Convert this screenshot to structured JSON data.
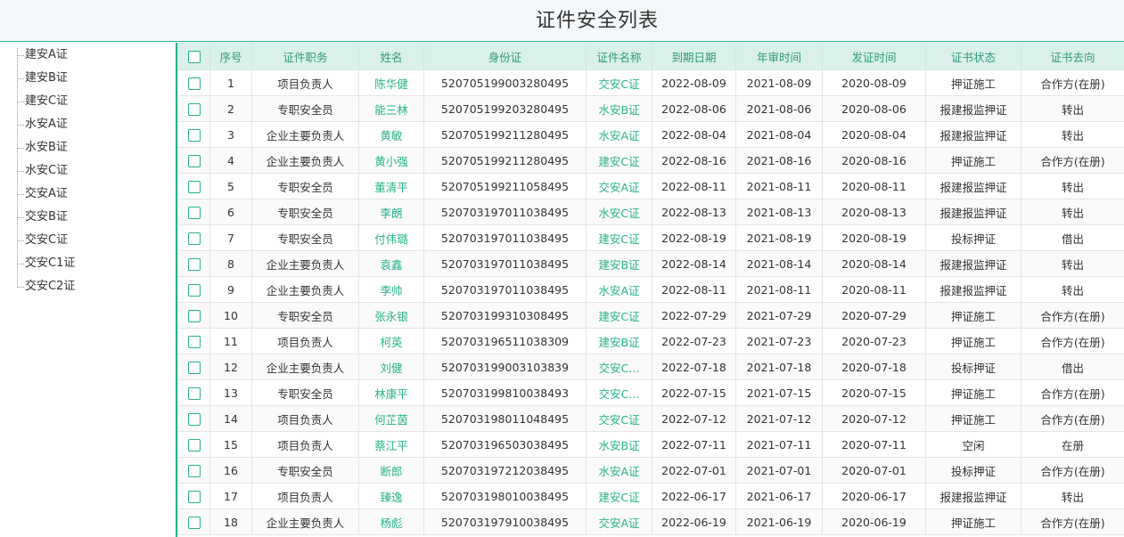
{
  "page": {
    "title": "证件安全列表"
  },
  "tree": {
    "items": [
      {
        "label": "建安A证"
      },
      {
        "label": "建安B证"
      },
      {
        "label": "建安C证"
      },
      {
        "label": "水安A证"
      },
      {
        "label": "水安B证"
      },
      {
        "label": "水安C证"
      },
      {
        "label": "交安A证"
      },
      {
        "label": "交安B证"
      },
      {
        "label": "交安C证"
      },
      {
        "label": "交安C1证"
      },
      {
        "label": "交安C2证"
      }
    ]
  },
  "table": {
    "columns": [
      "序号",
      "证件职务",
      "姓名",
      "身份证",
      "证件名称",
      "到期日期",
      "年审时间",
      "发证时间",
      "证书状态",
      "证书去向"
    ],
    "rows": [
      [
        "1",
        "项目负责人",
        "陈华健",
        "520705199003280495",
        "交安C证",
        "2022-08-09",
        "2021-08-09",
        "2020-08-09",
        "押证施工",
        "合作方(在册)"
      ],
      [
        "2",
        "专职安全员",
        "能三林",
        "520705199203280495",
        "水安B证",
        "2022-08-06",
        "2021-08-06",
        "2020-08-06",
        "报建报监押证",
        "转出"
      ],
      [
        "3",
        "企业主要负责人",
        "黄敏",
        "520705199211280495",
        "水安A证",
        "2022-08-04",
        "2021-08-04",
        "2020-08-04",
        "报建报监押证",
        "转出"
      ],
      [
        "4",
        "企业主要负责人",
        "黄小强",
        "520705199211280495",
        "建安C证",
        "2022-08-16",
        "2021-08-16",
        "2020-08-16",
        "押证施工",
        "合作方(在册)"
      ],
      [
        "5",
        "专职安全员",
        "董清平",
        "520705199211058495",
        "交安A证",
        "2022-08-11",
        "2021-08-11",
        "2020-08-11",
        "报建报监押证",
        "转出"
      ],
      [
        "6",
        "专职安全员",
        "李朗",
        "520703197011038495",
        "水安C证",
        "2022-08-13",
        "2021-08-13",
        "2020-08-13",
        "报建报监押证",
        "转出"
      ],
      [
        "7",
        "专职安全员",
        "付伟璐",
        "520703197011038495",
        "建安C证",
        "2022-08-19",
        "2021-08-19",
        "2020-08-19",
        "投标押证",
        "借出"
      ],
      [
        "8",
        "企业主要负责人",
        "袁鑫",
        "520703197011038495",
        "建安B证",
        "2022-08-14",
        "2021-08-14",
        "2020-08-14",
        "报建报监押证",
        "转出"
      ],
      [
        "9",
        "企业主要负责人",
        "李帅",
        "520703197011038495",
        "水安A证",
        "2022-08-11",
        "2021-08-11",
        "2020-08-11",
        "报建报监押证",
        "转出"
      ],
      [
        "10",
        "专职安全员",
        "张永银",
        "520703199310308495",
        "建安C证",
        "2022-07-29",
        "2021-07-29",
        "2020-07-29",
        "押证施工",
        "合作方(在册)"
      ],
      [
        "11",
        "项目负责人",
        "柯英",
        "520703196511038309",
        "建安B证",
        "2022-07-23",
        "2021-07-23",
        "2020-07-23",
        "押证施工",
        "合作方(在册)"
      ],
      [
        "12",
        "企业主要负责人",
        "刘健",
        "520703199003103839",
        "交安C...",
        "2022-07-18",
        "2021-07-18",
        "2020-07-18",
        "投标押证",
        "借出"
      ],
      [
        "13",
        "专职安全员",
        "林康平",
        "520703199810038493",
        "交安C...",
        "2022-07-15",
        "2021-07-15",
        "2020-07-15",
        "押证施工",
        "合作方(在册)"
      ],
      [
        "14",
        "项目负责人",
        "何芷茵",
        "520703198011048495",
        "交安C证",
        "2022-07-12",
        "2021-07-12",
        "2020-07-12",
        "押证施工",
        "合作方(在册)"
      ],
      [
        "15",
        "项目负责人",
        "蔡江平",
        "520703196503038495",
        "水安B证",
        "2022-07-11",
        "2021-07-11",
        "2020-07-11",
        "空闲",
        "在册"
      ],
      [
        "16",
        "专职安全员",
        "断郎",
        "520703197212038495",
        "水安A证",
        "2022-07-01",
        "2021-07-01",
        "2020-07-01",
        "投标押证",
        "合作方(在册)"
      ],
      [
        "17",
        "项目负责人",
        "臻逸",
        "520703198010038495",
        "建安C证",
        "2022-06-17",
        "2021-06-17",
        "2020-06-17",
        "报建报监押证",
        "转出"
      ],
      [
        "18",
        "企业主要负责人",
        "杨彪",
        "520703197910038495",
        "交安A证",
        "2022-06-19",
        "2021-06-19",
        "2020-06-19",
        "押证施工",
        "合作方(在册)"
      ]
    ]
  }
}
